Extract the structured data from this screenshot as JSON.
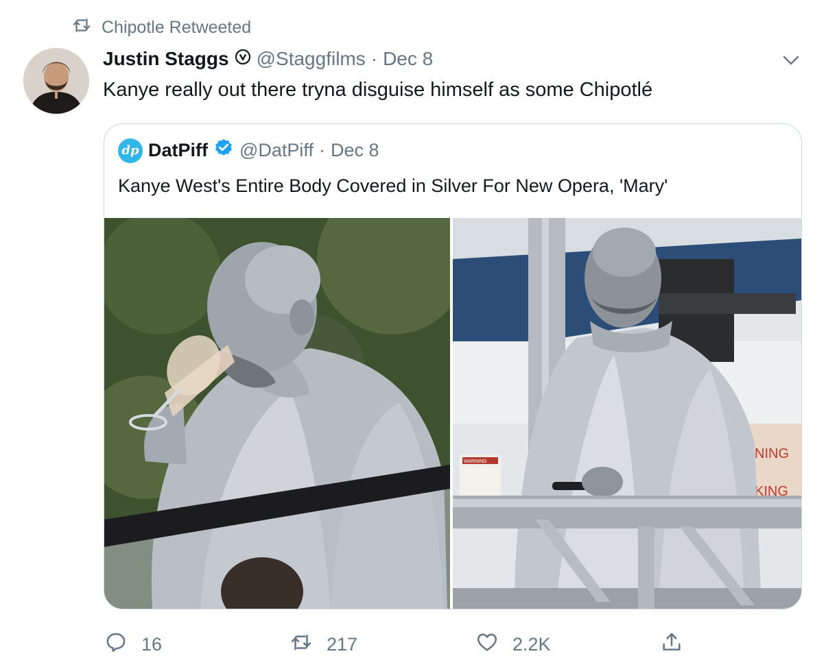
{
  "retweet": {
    "label": "Chipotle Retweeted",
    "icon": "retweet-icon"
  },
  "tweet": {
    "author": {
      "name": "Justin Staggs",
      "handle": "@Staggfilms",
      "badge_icon": "verified-circle-icon",
      "avatar_icon": "avatar-photo"
    },
    "separator": "·",
    "date": "Dec 8",
    "text": "Kanye really out there tryna disguise himself as some Chipotlé",
    "menu_icon": "chevron-down-icon"
  },
  "quote": {
    "logo_text": "dp",
    "name": "DatPiff",
    "handle": "@DatPiff",
    "separator": "·",
    "date": "Dec 8",
    "text": "Kanye West's Entire Body Covered in Silver For New Opera, 'Mary'",
    "accent": "#1da1f2",
    "media": [
      {
        "name": "photo-left",
        "sign_text": ""
      },
      {
        "name": "photo-right",
        "sign_text": "WARNING"
      }
    ]
  },
  "actions": {
    "reply": {
      "icon": "reply-icon",
      "count": "16"
    },
    "retweet": {
      "icon": "retweet-icon",
      "count": "217"
    },
    "like": {
      "icon": "heart-icon",
      "count": "2.2K"
    },
    "share": {
      "icon": "share-icon"
    }
  },
  "colors": {
    "muted": "#657786",
    "border": "#ccd6dd",
    "brand_blue": "#1da1f2"
  }
}
